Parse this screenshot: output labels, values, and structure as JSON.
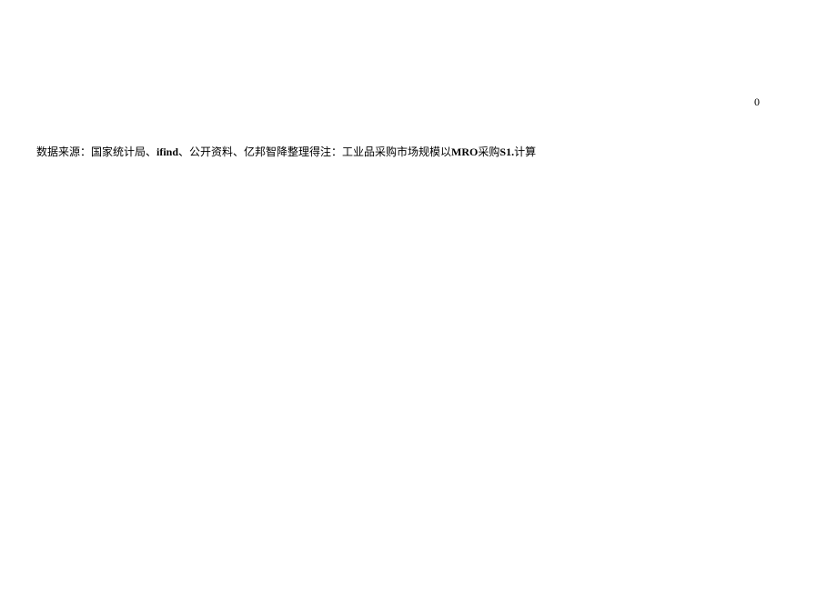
{
  "marker": "0",
  "source": {
    "prefix": "数据来源：国家统计局、",
    "ifind": "ifind",
    "middle1": "、公开资料、亿邦智降整理得注：工业品采购市场规模以",
    "mro": "MRO",
    "middle2": "采购",
    "s1": "S1.",
    "suffix": "计算"
  }
}
